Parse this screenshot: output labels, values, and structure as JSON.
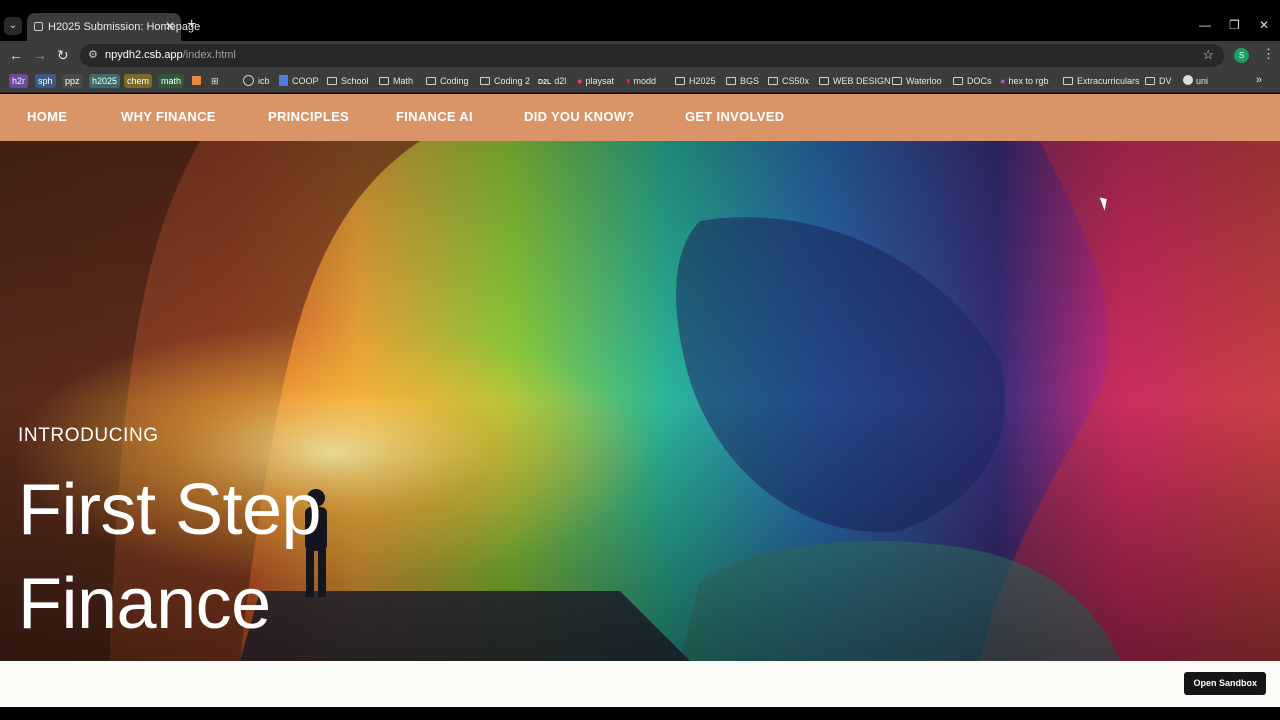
{
  "browser": {
    "tab": {
      "title": "H2025 Submission: Homepage",
      "close": "✕"
    },
    "new_tab": "+",
    "window_controls": {
      "minimize": "—",
      "restore": "❐",
      "close": "✕"
    },
    "address": {
      "domain": "npydh2.csb.app",
      "path": "/index.html"
    },
    "profile_initial": "S",
    "bookmarks": [
      {
        "label": "h2r",
        "kind": "chip",
        "color": "#6b4a9a"
      },
      {
        "label": "sph",
        "kind": "chip",
        "color": "#3a5a8a"
      },
      {
        "label": "ppz",
        "kind": "chip",
        "color": "#4a4a4a"
      },
      {
        "label": "h2025",
        "kind": "chip",
        "color": "#3b6b6b"
      },
      {
        "label": "chem",
        "kind": "chip",
        "color": "#7a6a2a"
      },
      {
        "label": "math",
        "kind": "chip",
        "color": "#2f5a3a"
      },
      {
        "label": "icb",
        "kind": "wordpress"
      },
      {
        "label": "COOP",
        "kind": "doc"
      },
      {
        "label": "School",
        "kind": "folder"
      },
      {
        "label": "Math",
        "kind": "folder"
      },
      {
        "label": "Coding",
        "kind": "folder"
      },
      {
        "label": "Coding 2",
        "kind": "folder"
      },
      {
        "label": "d2l",
        "kind": "site"
      },
      {
        "label": "playsat",
        "kind": "site"
      },
      {
        "label": "modd",
        "kind": "site"
      },
      {
        "label": "H2025",
        "kind": "folder"
      },
      {
        "label": "BGS",
        "kind": "folder"
      },
      {
        "label": "CS50x",
        "kind": "folder"
      },
      {
        "label": "WEB DESIGN",
        "kind": "folder"
      },
      {
        "label": "Waterloo",
        "kind": "folder"
      },
      {
        "label": "DOCs",
        "kind": "folder"
      },
      {
        "label": "hex to rgb",
        "kind": "site"
      },
      {
        "label": "Extracurriculars",
        "kind": "folder"
      },
      {
        "label": "DV",
        "kind": "folder"
      },
      {
        "label": "uni",
        "kind": "site"
      }
    ],
    "more_bookmarks": "»"
  },
  "site": {
    "nav": [
      "HOME",
      "WHY FINANCE",
      "PRINCIPLES",
      "FINANCE AI",
      "DID YOU KNOW?",
      "GET INVOLVED"
    ],
    "hero": {
      "eyebrow": "INTRODUCING",
      "title_line1": "First Step",
      "title_line2": "Finance"
    },
    "sandbox_button": "Open Sandbox"
  },
  "colors": {
    "nav_bg": "#d99468",
    "footer_bg": "#fbfbf7",
    "hero_text": "#ffffff"
  }
}
